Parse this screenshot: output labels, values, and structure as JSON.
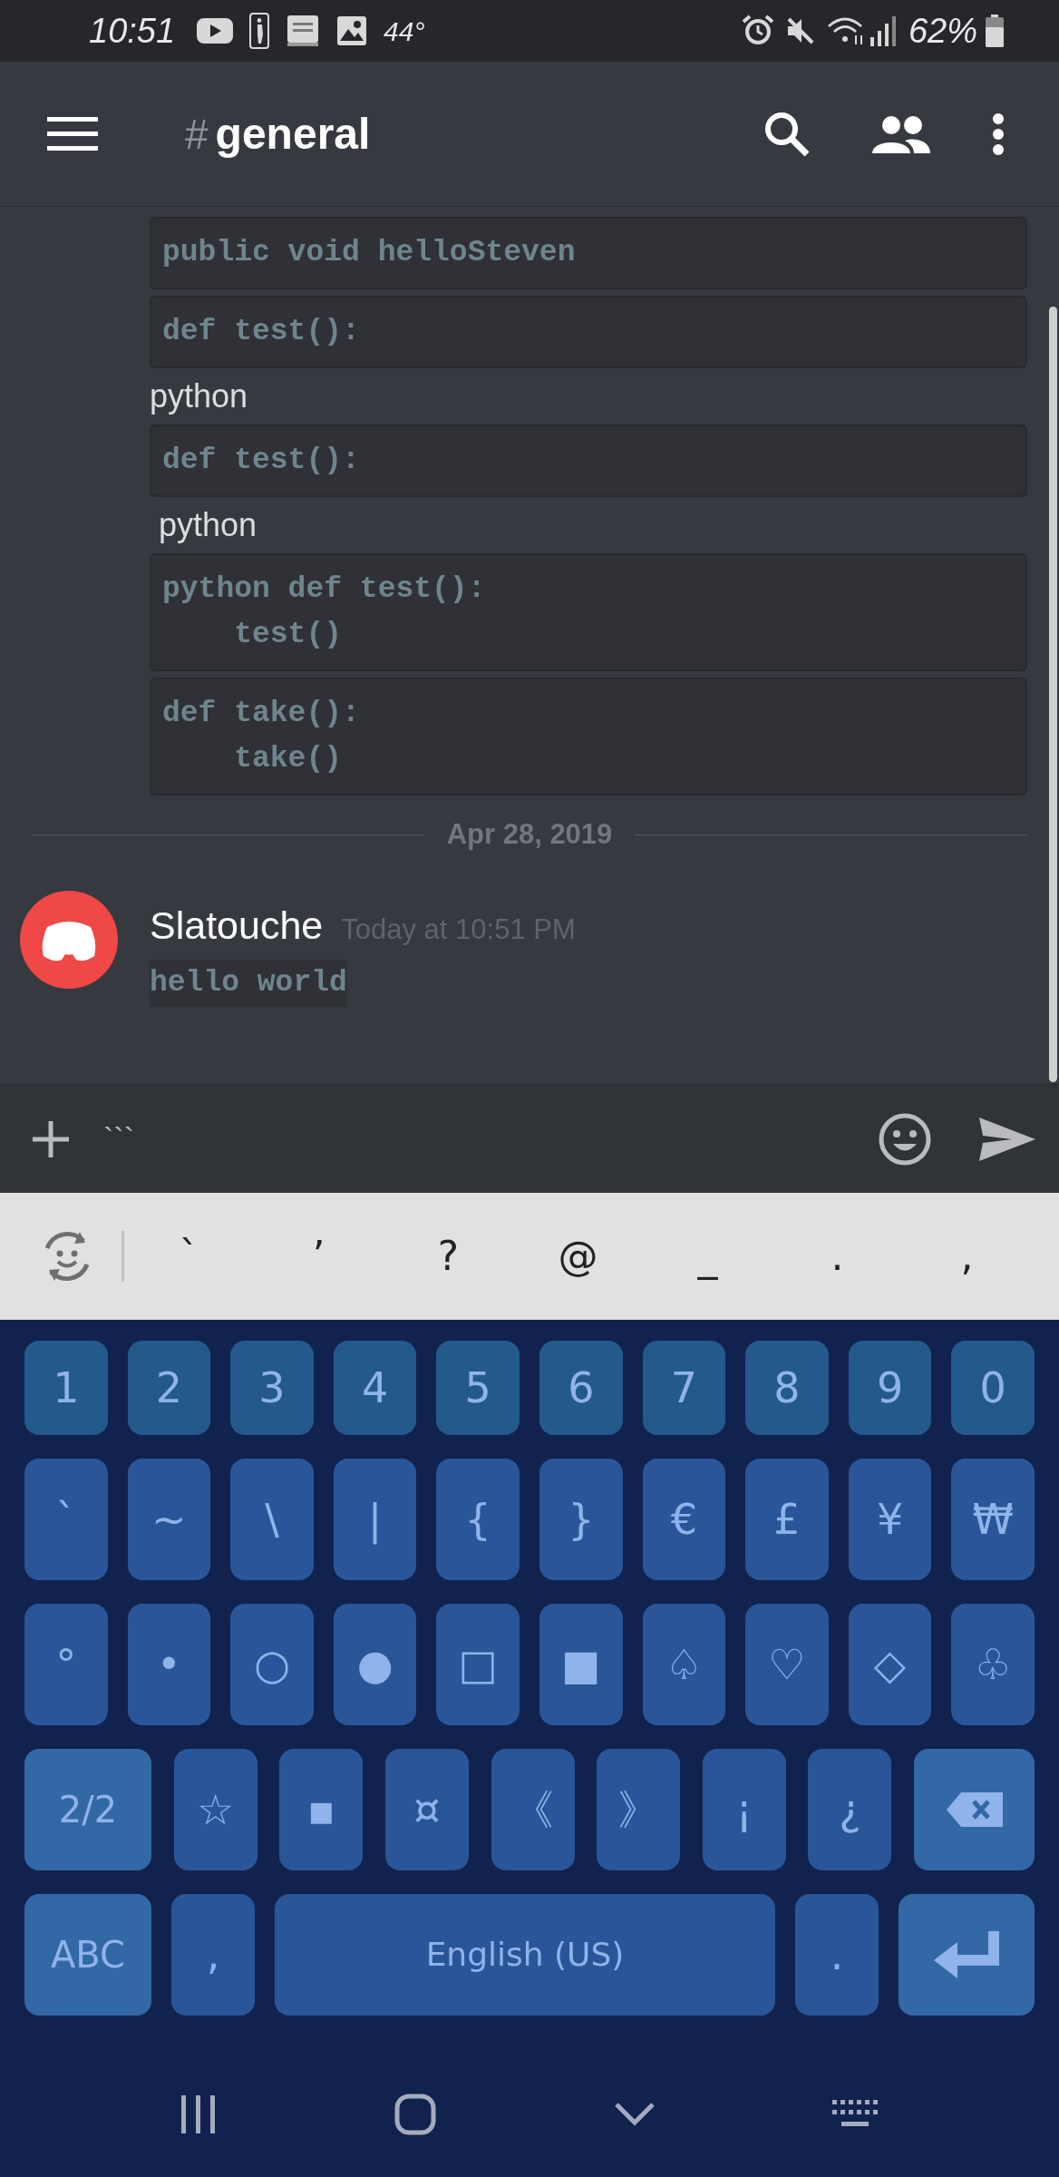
{
  "status_bar": {
    "time": "10:51",
    "temperature": "44°",
    "battery": "62%"
  },
  "header": {
    "channel_prefix": "#",
    "channel": "general"
  },
  "chat": [
    {
      "kind": "code",
      "text": "public void helloSteven"
    },
    {
      "kind": "code",
      "text": "def test():"
    },
    {
      "kind": "text",
      "text": "python"
    },
    {
      "kind": "code",
      "text": "def test():"
    },
    {
      "kind": "text",
      "text": " python"
    },
    {
      "kind": "code",
      "text": "python def test():\n    test()"
    },
    {
      "kind": "code",
      "text": "def take():\n    take()"
    }
  ],
  "date_divider": "Apr 28, 2019",
  "message": {
    "author": "Slatouche",
    "timestamp": "Today at 10:51 PM",
    "code": "hello world"
  },
  "composer": {
    "value": "```"
  },
  "suggestions": [
    "`",
    "’",
    "?",
    "@",
    "_",
    ".",
    ","
  ],
  "keyboard": [
    {
      "keys": [
        {
          "kind": "number",
          "label": "1"
        },
        {
          "kind": "number",
          "label": "2"
        },
        {
          "kind": "number",
          "label": "3"
        },
        {
          "kind": "number",
          "label": "4"
        },
        {
          "kind": "number",
          "label": "5"
        },
        {
          "kind": "number",
          "label": "6"
        },
        {
          "kind": "number",
          "label": "7"
        },
        {
          "kind": "number",
          "label": "8"
        },
        {
          "kind": "number",
          "label": "9"
        },
        {
          "kind": "number",
          "label": "0"
        }
      ]
    },
    {
      "keys": [
        {
          "kind": "symbol",
          "label": "`"
        },
        {
          "kind": "symbol",
          "label": "~"
        },
        {
          "kind": "symbol",
          "label": "\\"
        },
        {
          "kind": "symbol",
          "label": "|"
        },
        {
          "kind": "symbol",
          "label": "{"
        },
        {
          "kind": "symbol",
          "label": "}"
        },
        {
          "kind": "symbol",
          "label": "€"
        },
        {
          "kind": "symbol",
          "label": "£"
        },
        {
          "kind": "symbol",
          "label": "¥"
        },
        {
          "kind": "symbol",
          "label": "₩"
        }
      ]
    },
    {
      "keys": [
        {
          "kind": "symbol",
          "label": "°"
        },
        {
          "kind": "symbol",
          "label": "•"
        },
        {
          "kind": "symbol",
          "label": "○"
        },
        {
          "kind": "symbol",
          "label": "●"
        },
        {
          "kind": "symbol",
          "label": "□"
        },
        {
          "kind": "symbol",
          "label": "■"
        },
        {
          "kind": "symbol",
          "label": "♤"
        },
        {
          "kind": "symbol",
          "label": "♡"
        },
        {
          "kind": "symbol",
          "label": "◇"
        },
        {
          "kind": "symbol",
          "label": "♧"
        }
      ]
    },
    {
      "keys": [
        {
          "kind": "mode",
          "label": "2/2"
        },
        {
          "kind": "symbol",
          "label": "☆"
        },
        {
          "kind": "symbol",
          "label": "▪"
        },
        {
          "kind": "symbol",
          "label": "¤"
        },
        {
          "kind": "symbol",
          "label": "《"
        },
        {
          "kind": "symbol",
          "label": "》"
        },
        {
          "kind": "symbol",
          "label": "¡"
        },
        {
          "kind": "symbol",
          "label": "¿"
        },
        {
          "kind": "backspace"
        }
      ]
    },
    {
      "keys": [
        {
          "kind": "mode",
          "label": "ABC"
        },
        {
          "kind": "symbol",
          "label": ","
        },
        {
          "kind": "space",
          "label": "English (US)"
        },
        {
          "kind": "symbol",
          "label": "."
        },
        {
          "kind": "enter"
        }
      ]
    }
  ]
}
